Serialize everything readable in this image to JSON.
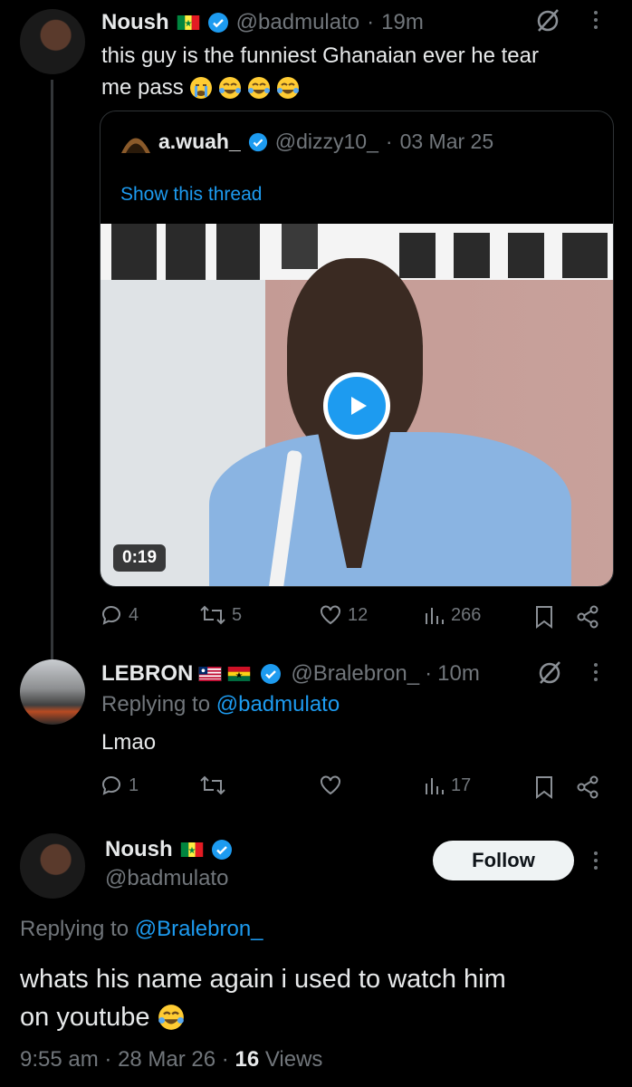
{
  "tweet1": {
    "name": "Noush",
    "handle": "@badmulato",
    "time": "19m",
    "text_line1": "this guy is the funniest Ghanaian ever he tear",
    "text_line2": "me pass",
    "quote": {
      "name": "a.wuah_",
      "handle": "@dizzy10_",
      "date": "03 Mar 25",
      "show_thread": "Show this thread",
      "duration": "0:19"
    },
    "actions": {
      "replies": "4",
      "retweets": "5",
      "likes": "12",
      "views": "266"
    }
  },
  "reply": {
    "name": "LEBRON",
    "handle": "@Bralebron_",
    "time": "10m",
    "replying_label": "Replying to",
    "replying_handle": "@badmulato",
    "text": "Lmao",
    "actions": {
      "replies": "1",
      "retweets": "",
      "likes": "",
      "views": "17"
    }
  },
  "main": {
    "name": "Noush",
    "handle": "@badmulato",
    "follow_label": "Follow",
    "replying_label": "Replying to",
    "replying_handle": "@Bralebron_",
    "text_line1": "whats his name again i used to watch him",
    "text_line2": "on youtube",
    "time": "9:55 am",
    "date": "28 Mar 26",
    "views_count": "16",
    "views_label": "Views"
  },
  "colors": {
    "accent": "#1d9bf0",
    "muted": "#71767b",
    "background": "#000000"
  }
}
